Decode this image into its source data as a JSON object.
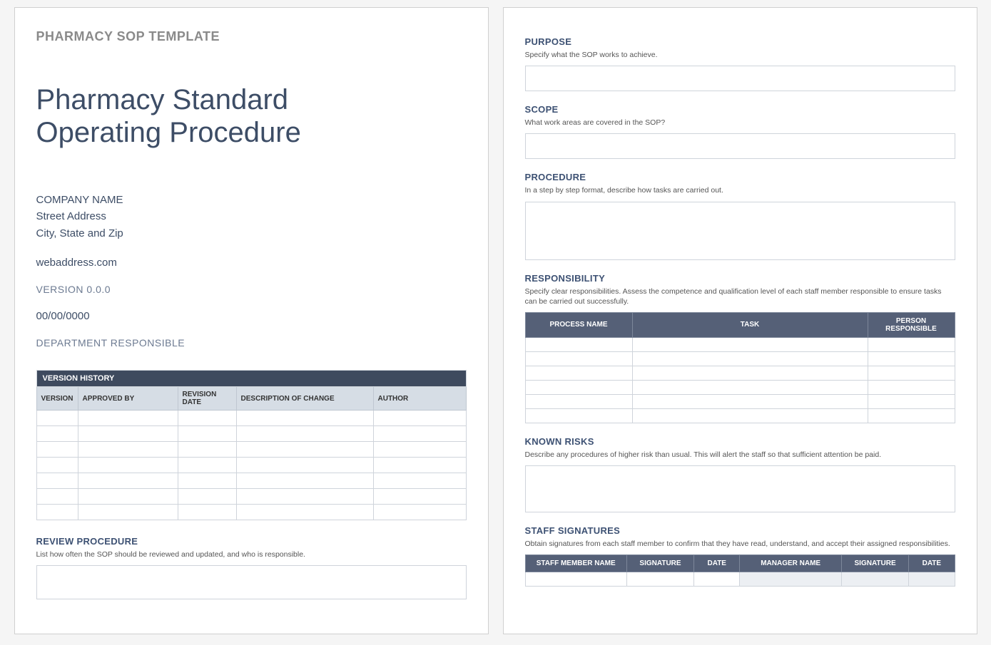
{
  "page1": {
    "header": "PHARMACY SOP TEMPLATE",
    "title_line1": "Pharmacy Standard",
    "title_line2": "Operating Procedure",
    "company": "COMPANY NAME",
    "street": "Street Address",
    "csz": "City, State and Zip",
    "web": "webaddress.com",
    "version": "VERSION 0.0.0",
    "date": "00/00/0000",
    "dept": "DEPARTMENT RESPONSIBLE",
    "vh_title": "VERSION HISTORY",
    "vh_cols": {
      "version": "VERSION",
      "approved_by": "APPROVED BY",
      "revision_date": "REVISION DATE",
      "desc": "DESCRIPTION OF CHANGE",
      "author": "AUTHOR"
    },
    "review": {
      "heading": "REVIEW PROCEDURE",
      "desc": "List how often the SOP should be reviewed and updated, and who is responsible."
    }
  },
  "page2": {
    "purpose": {
      "heading": "PURPOSE",
      "desc": "Specify what the SOP works to achieve."
    },
    "scope": {
      "heading": "SCOPE",
      "desc": "What work areas are covered in the SOP?"
    },
    "procedure": {
      "heading": "PROCEDURE",
      "desc": "In a step by step format, describe how tasks are carried out."
    },
    "responsibility": {
      "heading": "RESPONSIBILITY",
      "desc": "Specify clear responsibilities.  Assess the competence and qualification level of each staff member responsible to ensure tasks can be carried out successfully.",
      "cols": {
        "process": "PROCESS NAME",
        "task": "TASK",
        "person": "PERSON RESPONSIBLE"
      }
    },
    "known_risks": {
      "heading": "KNOWN RISKS",
      "desc": "Describe any procedures of higher risk than usual.  This will alert the staff so that sufficient attention be paid."
    },
    "signatures": {
      "heading": "STAFF SIGNATURES",
      "desc": "Obtain signatures from each staff member to confirm that they have read, understand, and accept their assigned responsibilities.",
      "cols": {
        "staff_name": "STAFF MEMBER NAME",
        "sig": "SIGNATURE",
        "date": "DATE",
        "mgr_name": "MANAGER NAME",
        "sig2": "SIGNATURE",
        "date2": "DATE"
      }
    }
  }
}
